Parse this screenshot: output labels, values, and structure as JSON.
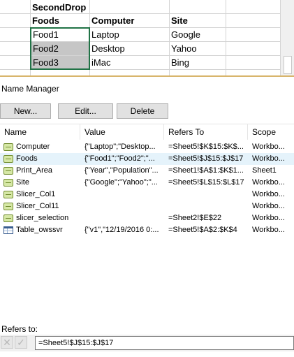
{
  "sheet": {
    "header_title": "SecondDrop",
    "columns": [
      "Foods",
      "Computer",
      "Site"
    ],
    "rows": [
      [
        "Food1",
        "Laptop",
        "Google"
      ],
      [
        "Food2",
        "Desktop",
        "Yahoo"
      ],
      [
        "Food3",
        "iMac",
        "Bing"
      ]
    ],
    "selection_color": "#217346"
  },
  "dialog": {
    "title": "Name Manager",
    "buttons": {
      "new": "New...",
      "edit": "Edit...",
      "delete": "Delete"
    },
    "list_headers": [
      "Name",
      "Value",
      "Refers To",
      "Scope"
    ],
    "names": [
      {
        "name": "Computer",
        "value": "{\"Laptop\";\"Desktop...",
        "refers_to": "=Sheet5!$K$15:$K$...",
        "scope": "Workbo...",
        "icon": "defined-name-icon"
      },
      {
        "name": "Foods",
        "value": "{\"Food1\";\"Food2\";\"...",
        "refers_to": "=Sheet5!$J$15:$J$17",
        "scope": "Workbo...",
        "icon": "defined-name-icon",
        "selected": true
      },
      {
        "name": "Print_Area",
        "value": "{\"Year\",\"Population\"...",
        "refers_to": "=Sheet1!$A$1:$K$1...",
        "scope": "Sheet1",
        "icon": "defined-name-icon"
      },
      {
        "name": "Site",
        "value": "{\"Google\";\"Yahoo\";\"...",
        "refers_to": "=Sheet5!$L$15:$L$17",
        "scope": "Workbo...",
        "icon": "defined-name-icon"
      },
      {
        "name": "Slicer_Col1",
        "value": "",
        "refers_to": "",
        "scope": "Workbo...",
        "icon": "defined-name-icon"
      },
      {
        "name": "Slicer_Col11",
        "value": "",
        "refers_to": "",
        "scope": "Workbo...",
        "icon": "defined-name-icon"
      },
      {
        "name": "slicer_selection",
        "value": "",
        "refers_to": "=Sheet2!$E$22",
        "scope": "Workbo...",
        "icon": "defined-name-icon"
      },
      {
        "name": "Table_owssvr",
        "value": "{\"v1\",\"12/19/2016 0:...",
        "refers_to": "=Sheet5!$A$2:$K$4",
        "scope": "Workbo...",
        "icon": "table-icon"
      }
    ],
    "refers_to_label": "Refers to:",
    "refers_to_value": "=Sheet5!$J$15:$J$17",
    "selected_row_color": "#e5f3fb"
  }
}
